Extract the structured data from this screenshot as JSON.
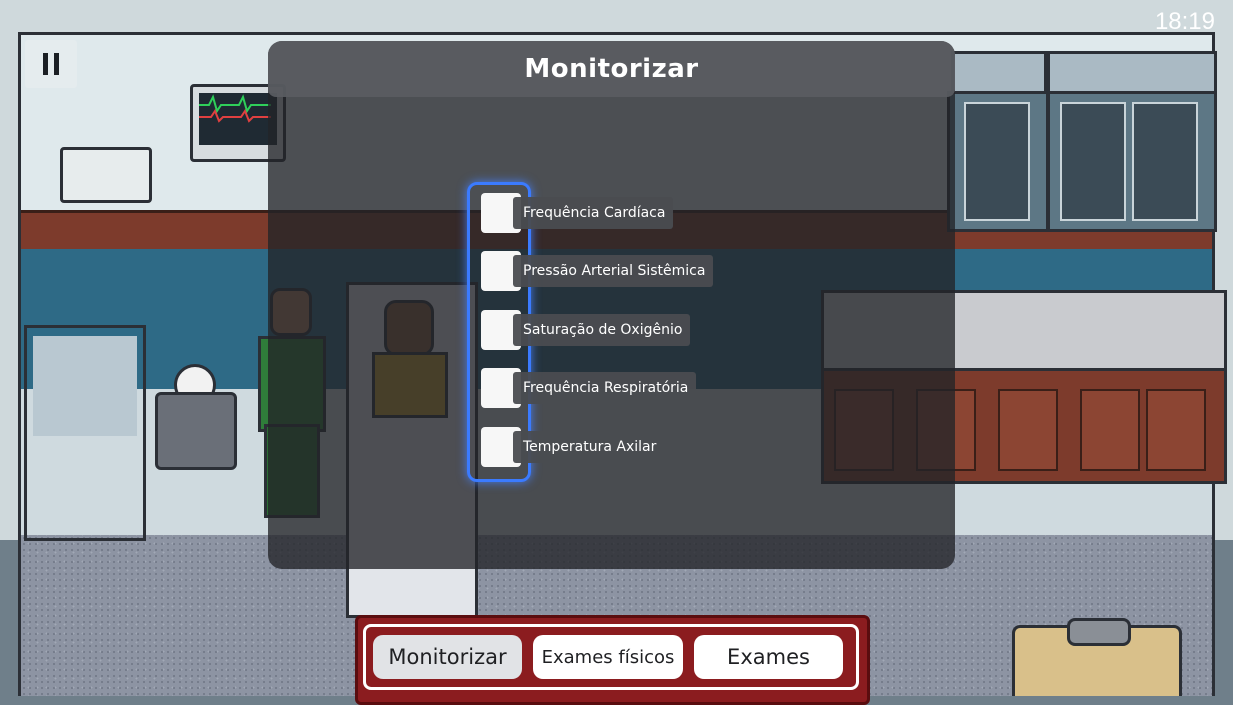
{
  "hud": {
    "time": "18:19"
  },
  "modal": {
    "title": "Monitorizar",
    "options": [
      {
        "label": "Frequência Cardíaca",
        "checked": false
      },
      {
        "label": "Pressão Arterial Sistêmica",
        "checked": false
      },
      {
        "label": "Saturação de Oxigênio",
        "checked": false
      },
      {
        "label": "Frequência Respiratória",
        "checked": false
      },
      {
        "label": "Temperatura Axilar",
        "checked": false
      }
    ]
  },
  "action_bar": {
    "buttons": [
      {
        "label": "Monitorizar",
        "active": true
      },
      {
        "label": "Exames físicos",
        "active": false
      },
      {
        "label": "Exames",
        "active": false
      }
    ]
  },
  "colors": {
    "selection_border": "#3b7bff",
    "action_bar_background": "#8b1c1f"
  },
  "icons": {
    "pause": "pause-icon"
  }
}
